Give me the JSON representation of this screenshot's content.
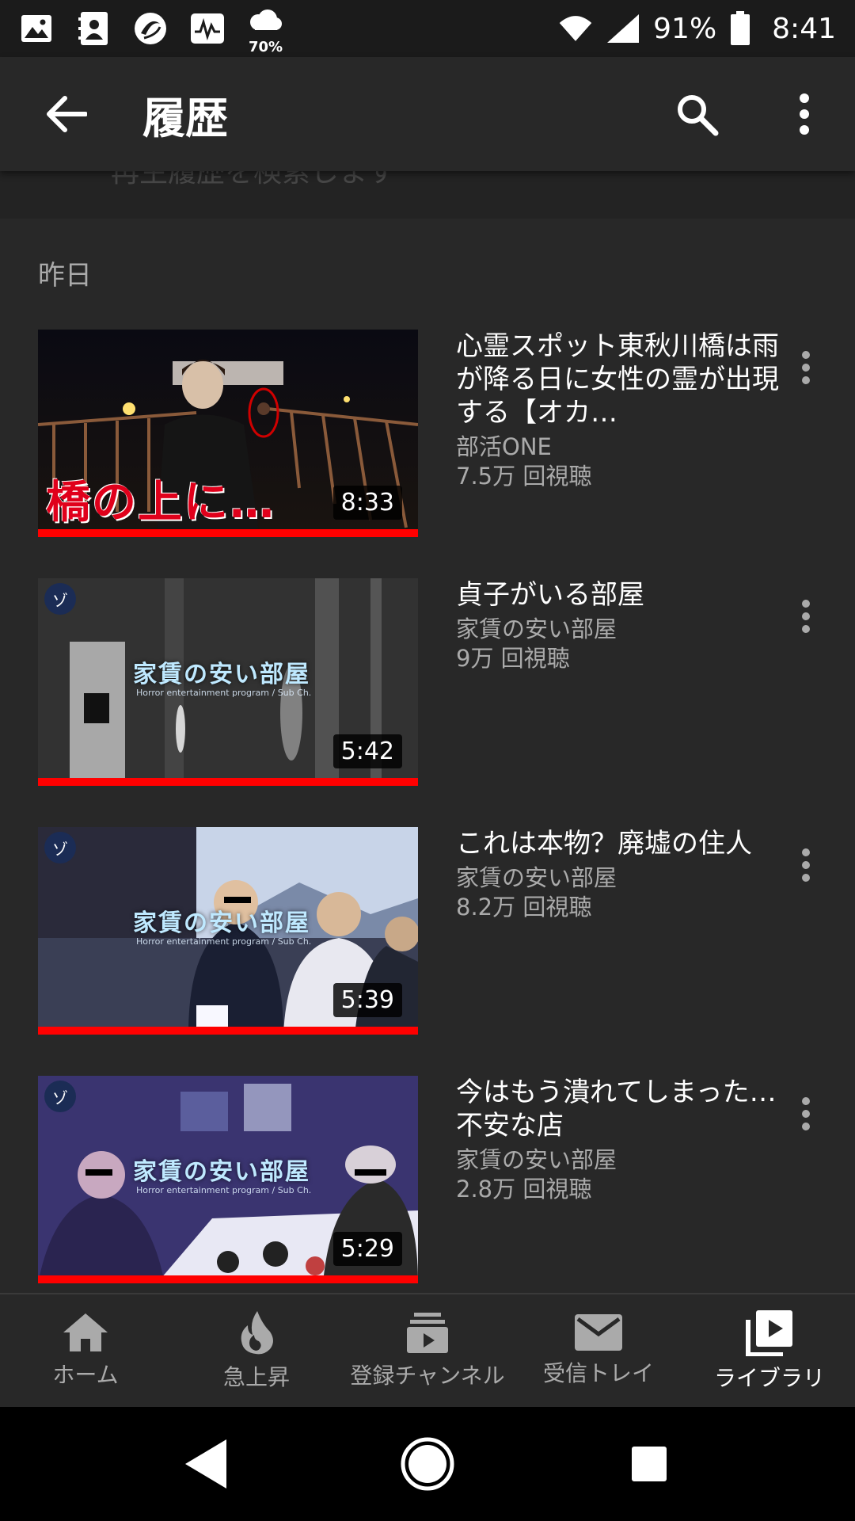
{
  "status_bar": {
    "weather_percent": "70%",
    "battery_percent": "91%",
    "time": "8:41"
  },
  "app_bar": {
    "title": "履歴"
  },
  "search": {
    "placeholder": "再生履歴を検索します"
  },
  "section": {
    "label": "昨日"
  },
  "videos": [
    {
      "title": "心霊スポット東秋川橋は雨が降る日に女性の霊が出現する【オカ…",
      "channel": "部活ONE",
      "views": "7.5万 回視聴",
      "duration": "8:33",
      "thumb_text": "橋の上に…",
      "watched_fraction": 1.0
    },
    {
      "title": "貞子がいる部屋",
      "channel": "家賃の安い部屋",
      "views": "9万 回視聴",
      "duration": "5:42",
      "thumb_text": "家賃の安い部屋",
      "thumb_subtext": "Horror entertainment program / Sub Ch.",
      "badge": "ゾ",
      "watched_fraction": 1.0
    },
    {
      "title": "これは本物？廃墟の住人",
      "channel": "家賃の安い部屋",
      "views": "8.2万 回視聴",
      "duration": "5:39",
      "thumb_text": "家賃の安い部屋",
      "thumb_subtext": "Horror entertainment program / Sub Ch.",
      "badge": "ゾ",
      "watched_fraction": 1.0
    },
    {
      "title": "今はもう潰れてしまった…不安な店",
      "channel": "家賃の安い部屋",
      "views": "2.8万 回視聴",
      "duration": "5:29",
      "thumb_text": "家賃の安い部屋",
      "thumb_subtext": "Horror entertainment program / Sub Ch.",
      "badge": "ゾ",
      "watched_fraction": 1.0
    }
  ],
  "bottom_nav": {
    "items": [
      {
        "label": "ホーム",
        "icon": "home-icon"
      },
      {
        "label": "急上昇",
        "icon": "fire-icon"
      },
      {
        "label": "登録チャンネル",
        "icon": "subscriptions-icon"
      },
      {
        "label": "受信トレイ",
        "icon": "mail-icon"
      },
      {
        "label": "ライブラリ",
        "icon": "library-icon",
        "active": true
      }
    ]
  },
  "colors": {
    "background": "#282828",
    "accent": "#ff0000",
    "secondary_text": "#aaaaaa"
  }
}
